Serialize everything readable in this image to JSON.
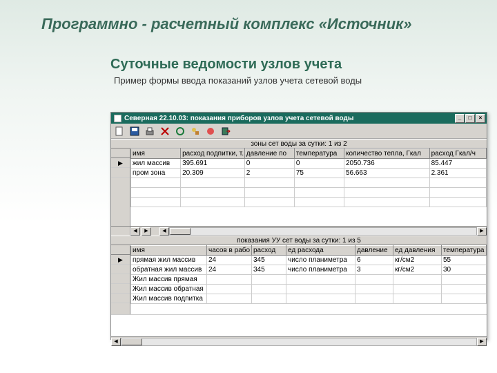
{
  "page": {
    "title": "Программно - расчетный комплекс «Источник»",
    "section_title": "Суточные ведомости узлов учета",
    "section_sub": "Пример формы ввода показаний узлов учета сетевой воды"
  },
  "window": {
    "title": "Северная 22.10.03: показания приборов узлов учета сетевой воды",
    "win_min": "_",
    "win_max": "□",
    "win_close": "×"
  },
  "grid1": {
    "caption": "зоны сет воды за сутки: 1 из 2",
    "headers": [
      "имя",
      "расход подпитки, т.",
      "давление по",
      "температура",
      "количество тепла, Гкал",
      "расход Гкал/ч"
    ],
    "rows": [
      {
        "marker": "▶",
        "cells": [
          "жил массив",
          "395.691",
          "0",
          "0",
          "2050.736",
          "85.447"
        ]
      },
      {
        "marker": "",
        "cells": [
          "пром зона",
          "20.309",
          "2",
          "75",
          "56.663",
          "2.361"
        ]
      }
    ]
  },
  "grid2": {
    "caption": "показания УУ сет воды за сутки: 1 из 5",
    "headers": [
      "имя",
      "часов в рабо",
      "расход",
      "ед расхода",
      "давление",
      "ед давления",
      "температура"
    ],
    "rows": [
      {
        "marker": "▶",
        "cells": [
          "прямая жил массив",
          "24",
          "345",
          "число планиметра",
          "6",
          "кг/см2",
          "55"
        ]
      },
      {
        "marker": "",
        "cells": [
          "обратная жил массив",
          "24",
          "345",
          "число планиметра",
          "3",
          "кг/см2",
          "30"
        ]
      },
      {
        "marker": "",
        "cells": [
          "Жил массив прямая",
          "",
          "",
          "",
          "",
          "",
          ""
        ]
      },
      {
        "marker": "",
        "cells": [
          "Жил массив обратная",
          "",
          "",
          "",
          "",
          "",
          ""
        ]
      },
      {
        "marker": "",
        "cells": [
          "Жил массив подпитка",
          "",
          "",
          "",
          "",
          "",
          ""
        ]
      }
    ]
  },
  "scroll": {
    "left": "◀",
    "right": "▶"
  }
}
